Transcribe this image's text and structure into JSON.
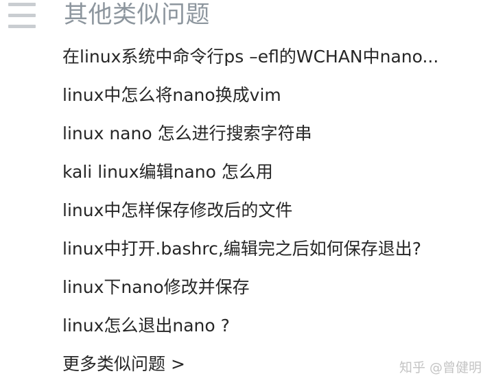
{
  "header": {
    "menu_icon": "hamburger-menu-icon",
    "title": "其他类似问题"
  },
  "questions": [
    {
      "label": "在linux系统中命令行ps –efl的WCHAN中nano..."
    },
    {
      "label": "linux中怎么将nano换成vim"
    },
    {
      "label": "linux nano 怎么进行搜索字符串"
    },
    {
      "label": "kali linux编辑nano 怎么用"
    },
    {
      "label": "linux中怎样保存修改后的文件"
    },
    {
      "label": "linux中打开.bashrc,编辑完之后如何保存退出?"
    },
    {
      "label": "linux下nano修改并保存"
    },
    {
      "label": "linux怎么退出nano ?"
    }
  ],
  "more_link": "更多类似问题 >",
  "watermark": "知乎 @曾健明",
  "colors": {
    "title": "#8d969e",
    "text": "#262626",
    "icon": "#c9cdd1",
    "watermark": "#c4c4c4"
  }
}
